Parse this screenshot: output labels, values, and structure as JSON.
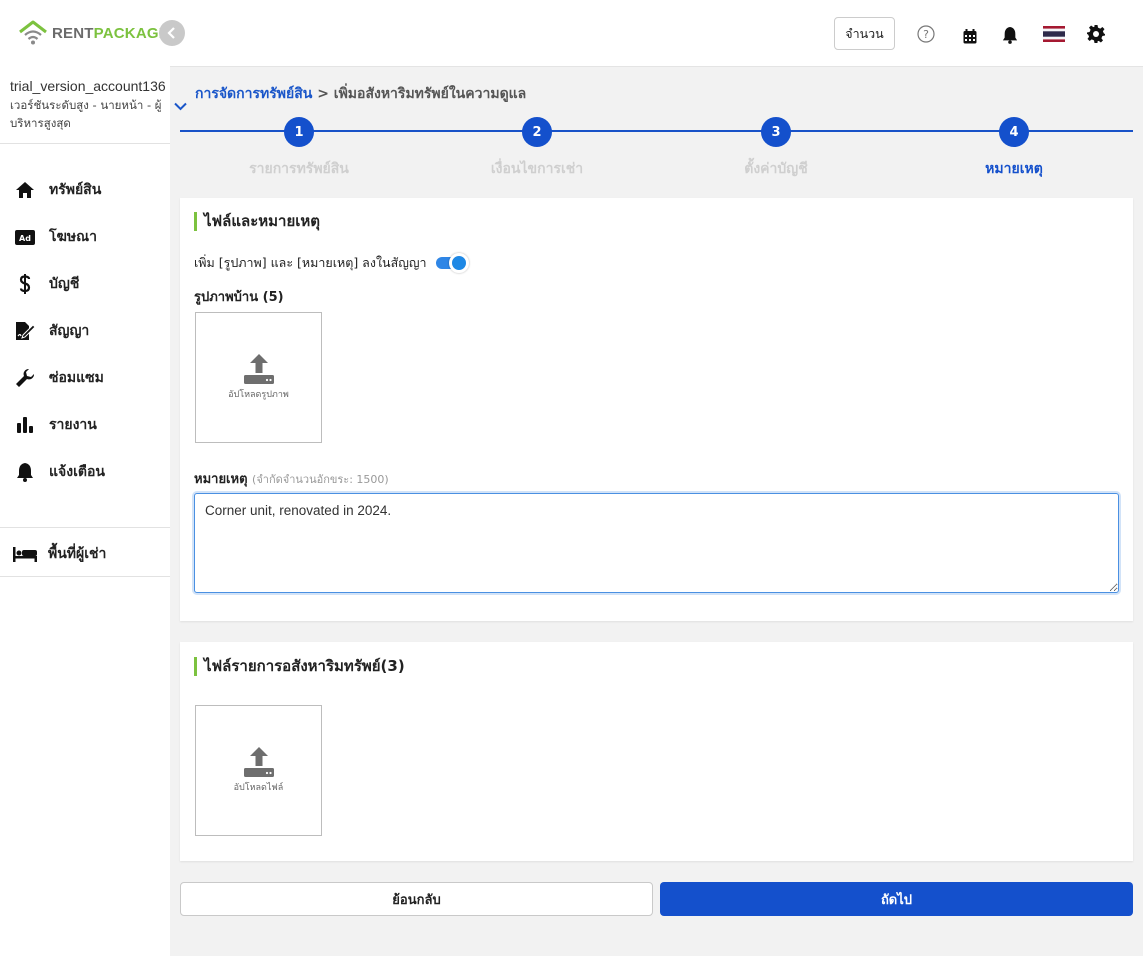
{
  "brand": {
    "part1": "RENT",
    "part2": "PACKAGE",
    "gray": "#6b6b6b",
    "green": "#7cc23f"
  },
  "account": {
    "name": "trial_version_account136",
    "role": "เวอร์ชันระดับสูง - นายหน้า - ผู้บริหารสูงสุด"
  },
  "sidebar": {
    "items": [
      {
        "label": "ทรัพย์สิน",
        "icon": "home-icon"
      },
      {
        "label": "โฆษณา",
        "icon": "ad-icon"
      },
      {
        "label": "บัญชี",
        "icon": "dollar-icon"
      },
      {
        "label": "สัญญา",
        "icon": "contract-icon"
      },
      {
        "label": "ซ่อมแซม",
        "icon": "wrench-icon"
      },
      {
        "label": "รายงาน",
        "icon": "bar-chart-icon"
      },
      {
        "label": "แจ้งเตือน",
        "icon": "bell-icon"
      }
    ],
    "tenant": {
      "label": "พื้นที่ผู้เช่า",
      "icon": "bed-icon"
    }
  },
  "topbar": {
    "qty_label": "จำนวน",
    "icons": [
      "help-icon",
      "calendar-icon",
      "bell-icon",
      "thai-flag-icon",
      "gear-icon"
    ]
  },
  "breadcrumb": {
    "root": "การจัดการทรัพย์สิน",
    "separator": ">",
    "current": "เพิ่มอสังหาริมทรัพย์ในความดูแล"
  },
  "steps": [
    {
      "number": "1",
      "label": "รายการทรัพย์สิน",
      "active": false
    },
    {
      "number": "2",
      "label": "เงื่อนไขการเช่า",
      "active": false
    },
    {
      "number": "3",
      "label": "ตั้งค่าบัญชี",
      "active": false
    },
    {
      "number": "4",
      "label": "หมายเหตุ",
      "active": true
    }
  ],
  "files_card": {
    "title": "ไฟล์และหมายเหตุ",
    "toggle_label": "เพิ่ม [รูปภาพ] และ [หมายเหตุ] ลงในสัญญา",
    "toggle_on": true,
    "photos_label": "รูปภาพบ้าน (5)",
    "upload_photo_label": "อัปโหลดรูปภาพ",
    "note_label": "หมายเหตุ",
    "note_hint": "(จำกัดจำนวนอักขระ: 1500)",
    "note_value": "Corner unit, renovated in 2024."
  },
  "asset_files_card": {
    "title": "ไฟล์รายการอสังหาริมทรัพย์(3)",
    "upload_file_label": "อัปโหลดไฟล์"
  },
  "buttons": {
    "back": "ย้อนกลับ",
    "next": "ถัดไป"
  },
  "colors": {
    "primary": "#1450cc",
    "accent": "#7cc23f"
  }
}
